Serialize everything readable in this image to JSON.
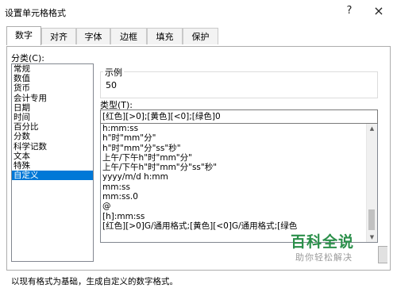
{
  "window": {
    "title": "设置单元格格式",
    "help_icon": "?",
    "close_icon": "×"
  },
  "tabs": [
    {
      "label": "数字"
    },
    {
      "label": "对齐"
    },
    {
      "label": "字体"
    },
    {
      "label": "边框"
    },
    {
      "label": "填充"
    },
    {
      "label": "保护"
    }
  ],
  "category": {
    "label": "分类(C):",
    "items": [
      "常规",
      "数值",
      "货币",
      "会计专用",
      "日期",
      "时间",
      "百分比",
      "分数",
      "科学记数",
      "文本",
      "特殊",
      "自定义"
    ],
    "selected_index": 11
  },
  "sample": {
    "label": "示例",
    "value": "50"
  },
  "type": {
    "label": "类型(T):",
    "value": "[红色][>0];[黄色][<0];[绿色]0",
    "list": [
      "h:mm:ss",
      "h\"时\"mm\"分\"",
      "h\"时\"mm\"分\"ss\"秒\"",
      "上午/下午h\"时\"mm\"分\"",
      "上午/下午h\"时\"mm\"分\"ss\"秒\"",
      "yyyy/m/d h:mm",
      "mm:ss",
      "mm:ss.0",
      "@",
      "[h]:mm:ss",
      "[红色][>0]G/通用格式;[黄色][<0]G/通用格式;[绿色"
    ]
  },
  "hint": "以现有格式为基础，生成自定义的数字格式。",
  "watermark": {
    "title": "百科全说",
    "subtitle": "助你轻松解决"
  }
}
